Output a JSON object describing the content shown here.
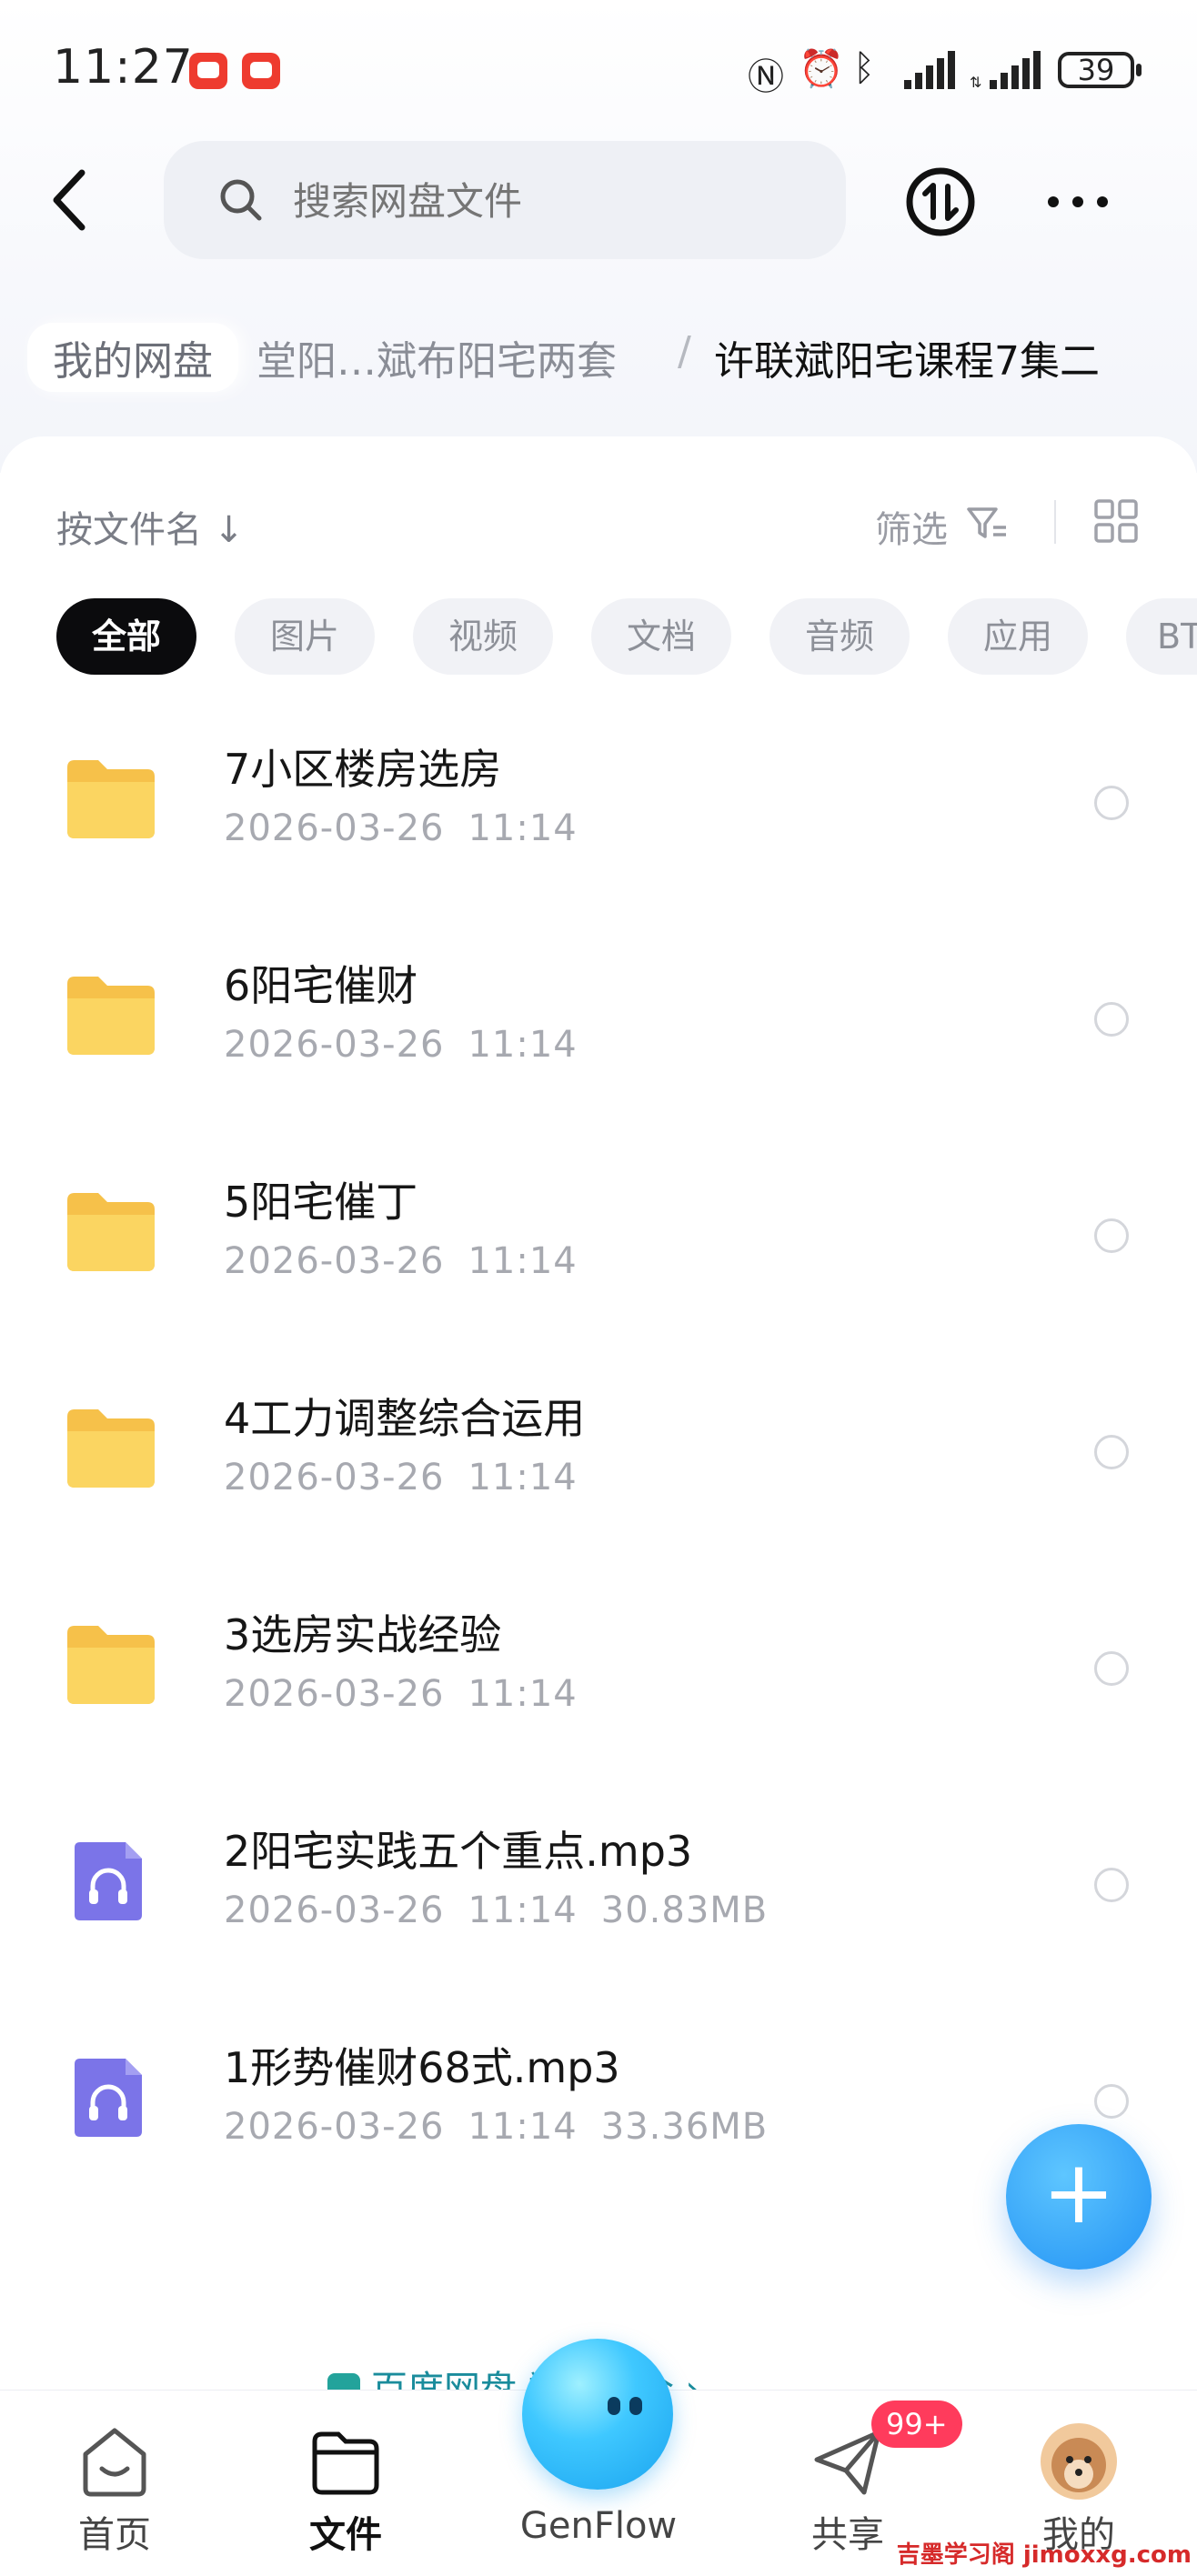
{
  "status_bar": {
    "time": "11:27",
    "battery": "39"
  },
  "header": {
    "search_placeholder": "搜索网盘文件"
  },
  "breadcrumb": {
    "root": "我的网盘",
    "middle": "堂阳…斌布阳宅两套",
    "separator": "/",
    "current": "许联斌阳宅课程7集二"
  },
  "toolbar": {
    "sort_label": "按文件名 ↓",
    "filter_label": "筛选"
  },
  "chips": [
    "全部",
    "图片",
    "视频",
    "文档",
    "音频",
    "应用",
    "BT"
  ],
  "files": [
    {
      "name": "7小区楼房选房",
      "date": "2026-03-26",
      "time": "11:14",
      "size": "",
      "type": "folder"
    },
    {
      "name": "6阳宅催财",
      "date": "2026-03-26",
      "time": "11:14",
      "size": "",
      "type": "folder"
    },
    {
      "name": "5阳宅催丁",
      "date": "2026-03-26",
      "time": "11:14",
      "size": "",
      "type": "folder"
    },
    {
      "name": "4工力调整综合运用",
      "date": "2026-03-26",
      "time": "11:14",
      "size": "",
      "type": "folder"
    },
    {
      "name": "3选房实战经验",
      "date": "2026-03-26",
      "time": "11:14",
      "size": "",
      "type": "folder"
    },
    {
      "name": "2阳宅实践五个重点.mp3",
      "date": "2026-03-26",
      "time": "11:14",
      "size": "30.83MB",
      "type": "audio"
    },
    {
      "name": "1形势催财68式.mp3",
      "date": "2026-03-26",
      "time": "11:14",
      "size": "33.36MB",
      "type": "audio"
    }
  ],
  "fab_label": "+",
  "notice": {
    "text": "百度网盘      数据安全 ›"
  },
  "bottom_nav": {
    "home": "首页",
    "files": "文件",
    "genflow": "GenFlow",
    "share": "共享",
    "me": "我的",
    "share_badge": "99+"
  },
  "watermark": "吉墨学习阁 jimoxxg.com",
  "colors": {
    "accent": "#2292f4",
    "folder": "#f7c948",
    "audio": "#7b74e8",
    "badge": "#ff3b5c"
  }
}
